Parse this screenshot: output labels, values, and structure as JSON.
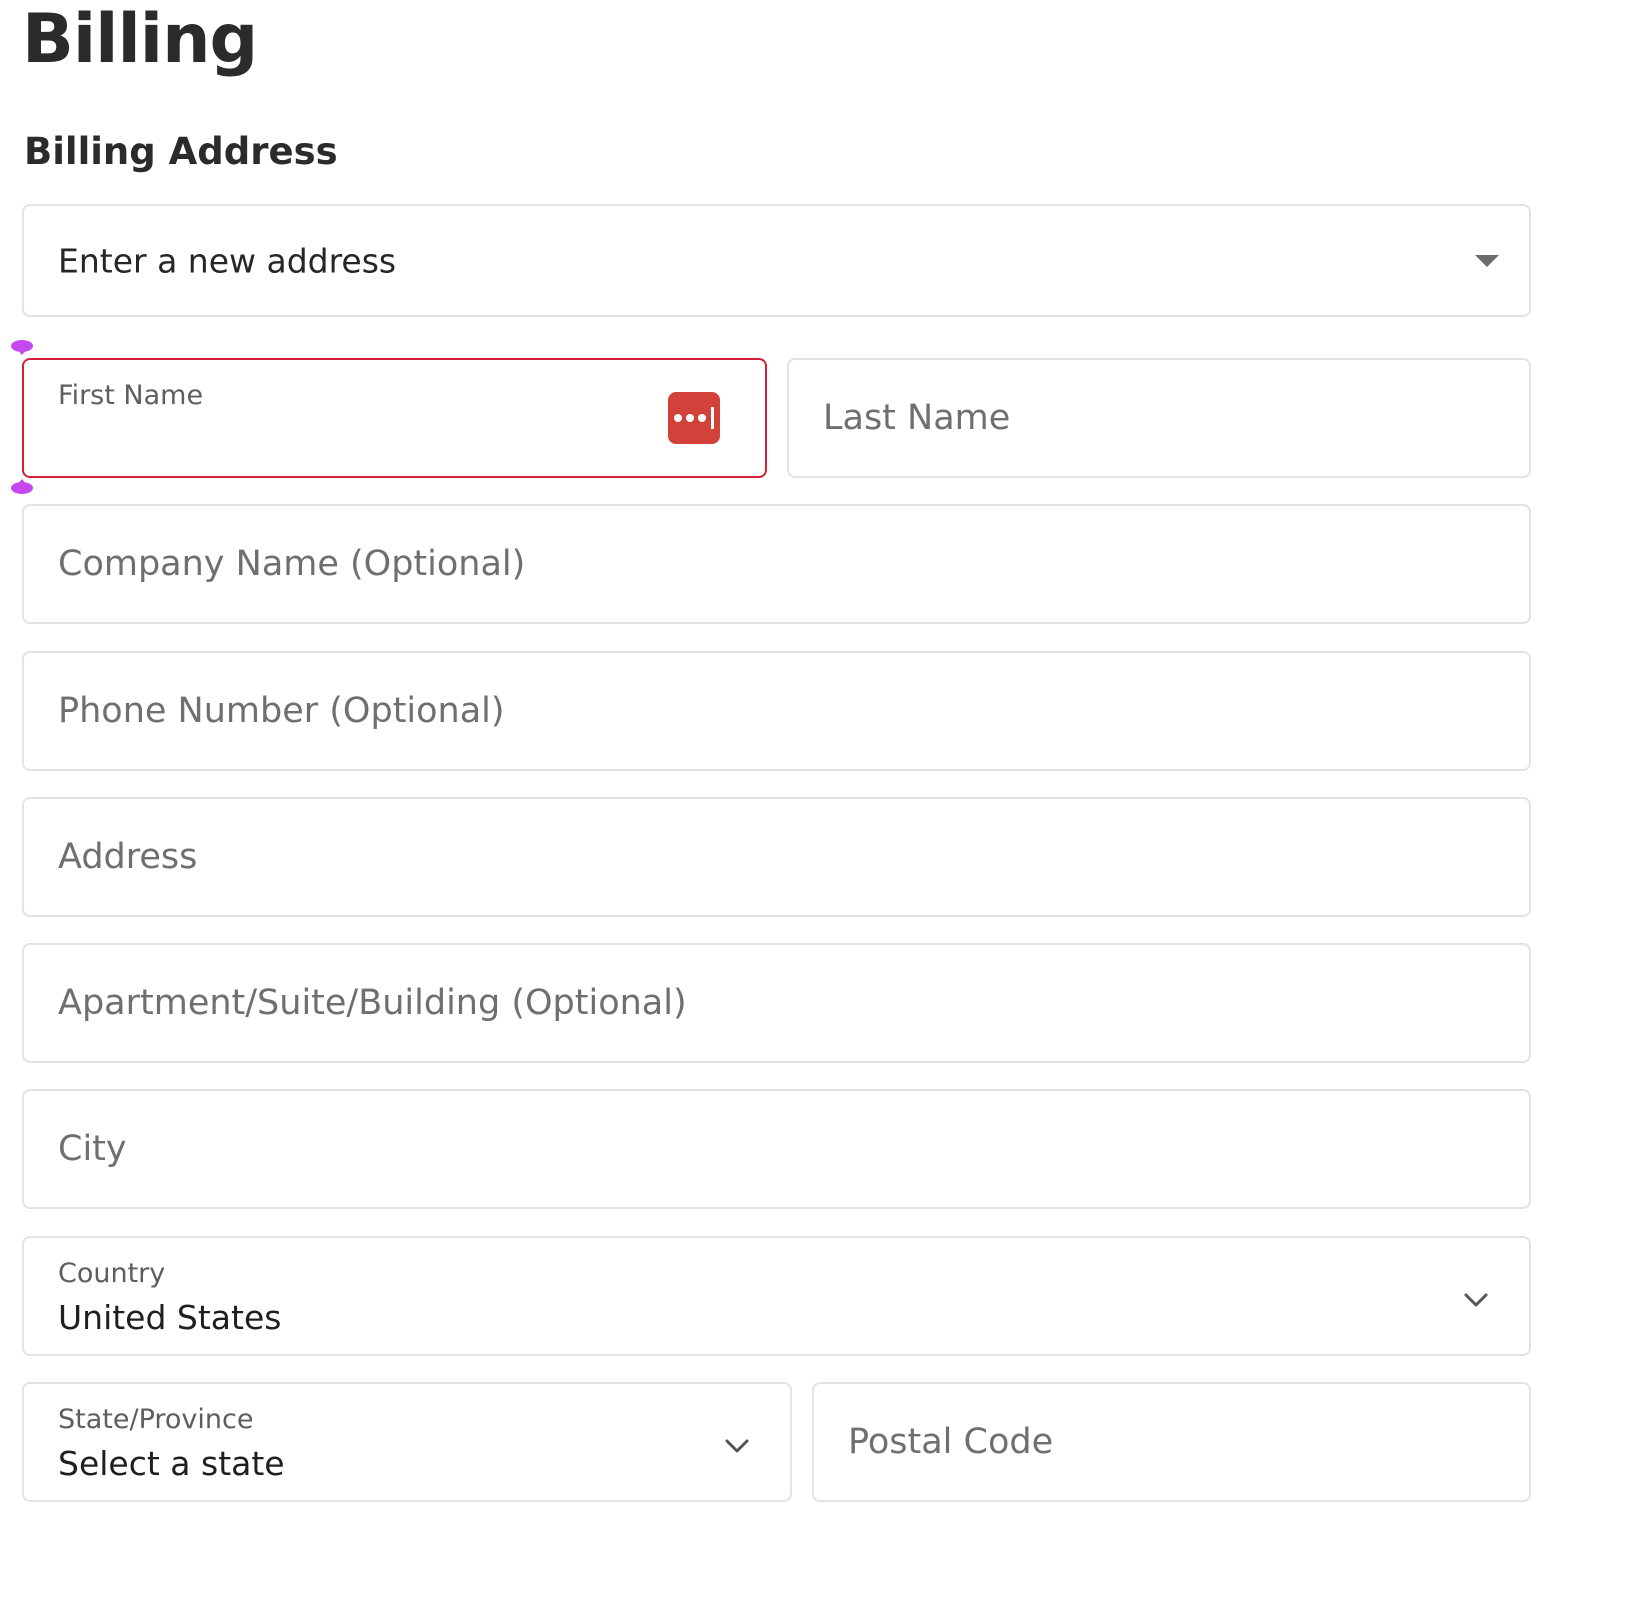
{
  "page": {
    "title": "Billing"
  },
  "billing_address": {
    "heading": "Billing Address",
    "address_select": {
      "value": "Enter a new address",
      "icon": "caret-down-icon"
    },
    "first_name": {
      "label": "First Name",
      "value": "",
      "autofill_icon": "password-manager-icon"
    },
    "last_name": {
      "placeholder": "Last Name",
      "value": ""
    },
    "company_name": {
      "placeholder": "Company Name (Optional)",
      "value": ""
    },
    "phone_number": {
      "placeholder": "Phone Number (Optional)",
      "value": ""
    },
    "address": {
      "placeholder": "Address",
      "value": ""
    },
    "apartment": {
      "placeholder": "Apartment/Suite/Building (Optional)",
      "value": ""
    },
    "city": {
      "placeholder": "City",
      "value": ""
    },
    "country": {
      "label": "Country",
      "value": "United States",
      "icon": "chevron-down-icon"
    },
    "state": {
      "label": "State/Province",
      "value": "Select a state",
      "icon": "chevron-down-icon"
    },
    "postal_code": {
      "placeholder": "Postal Code",
      "value": ""
    }
  },
  "colors": {
    "focus_border": "#d2203a",
    "autofill_icon_bg": "#d2413a",
    "selection_handle": "#c447f0",
    "field_border": "#e3e3e3"
  }
}
